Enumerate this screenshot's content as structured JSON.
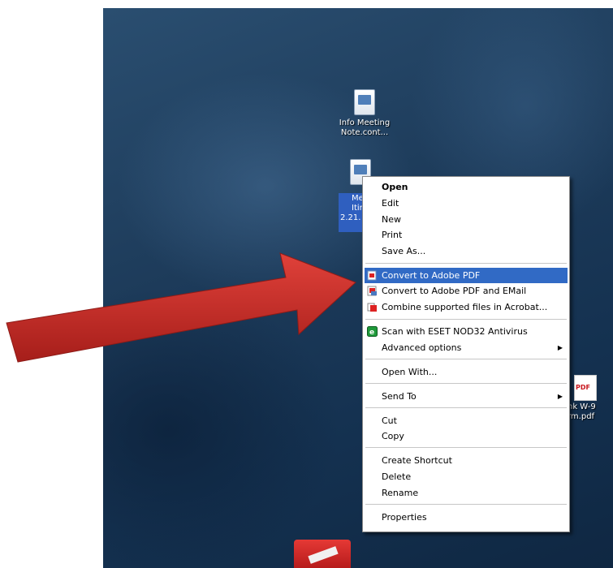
{
  "desktop": {
    "icons": [
      {
        "label_line1": "Info Meeting",
        "label_line2": "Note.cont..."
      },
      {
        "label_line1": "Me",
        "label_line2": "Itin",
        "label_line3": "2.21."
      },
      {
        "label_line1": "nk W-9",
        "label_line2": "rm.pdf"
      }
    ]
  },
  "context_menu": {
    "items": [
      {
        "label": "Open"
      },
      {
        "label": "Edit"
      },
      {
        "label": "New"
      },
      {
        "label": "Print"
      },
      {
        "label": "Save As..."
      },
      {
        "label": "Convert to Adobe PDF",
        "icon": "adobe-pdf-icon"
      },
      {
        "label": "Convert to Adobe PDF and EMail",
        "icon": "adobe-pdf-email-icon"
      },
      {
        "label": "Combine supported files in Acrobat...",
        "icon": "acrobat-combine-icon"
      },
      {
        "label": "Scan with ESET NOD32 Antivirus",
        "icon": "eset-icon"
      },
      {
        "label": "Advanced options",
        "submenu": "▶"
      },
      {
        "label": "Open With..."
      },
      {
        "label": "Send To",
        "submenu": "▶"
      },
      {
        "label": "Cut"
      },
      {
        "label": "Copy"
      },
      {
        "label": "Create Shortcut"
      },
      {
        "label": "Delete"
      },
      {
        "label": "Rename"
      },
      {
        "label": "Properties"
      }
    ]
  },
  "colors": {
    "highlight": "#316ac5",
    "arrow": "#c62828"
  }
}
